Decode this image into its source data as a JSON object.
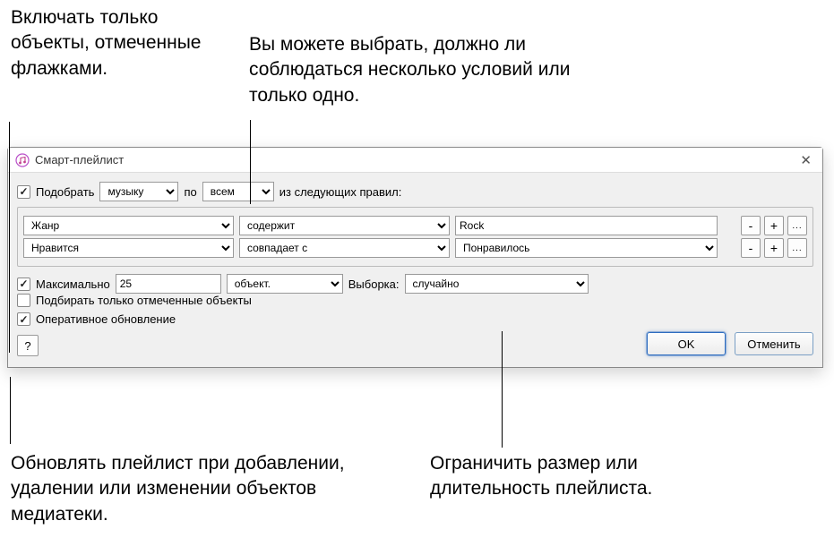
{
  "callouts": {
    "top_left": "Включать только объекты, отмеченные флажками.",
    "top_right": "Вы можете выбрать, должно ли соблюдаться несколько условий или только одно.",
    "bottom_left": "Обновлять плейлист при добавлении, удалении или изменении объектов медиатеки.",
    "bottom_right": "Ограничить размер или длительность плейлиста."
  },
  "dialog": {
    "title": "Смарт-плейлист",
    "match": {
      "checkbox_label": "Подобрать",
      "media_select": "музыку",
      "by_label": "по",
      "mode_select": "всем",
      "suffix": "из следующих правил:"
    },
    "rules": [
      {
        "field": "Жанр",
        "op": "содержит",
        "value": "Rock",
        "value_is_select": false
      },
      {
        "field": "Нравится",
        "op": "совпадает с",
        "value": "Понравилось",
        "value_is_select": true
      }
    ],
    "limit": {
      "checkbox_label": "Максимально",
      "value": "25",
      "unit": "объект.",
      "sample_label": "Выборка:",
      "sample_value": "случайно"
    },
    "only_checked_label": "Подбирать только отмеченные объекты",
    "live_update_label": "Оперативное обновление",
    "buttons": {
      "ok": "OK",
      "cancel": "Отменить",
      "help": "?"
    },
    "rule_buttons": {
      "minus": "-",
      "plus": "+",
      "more": "..."
    }
  }
}
